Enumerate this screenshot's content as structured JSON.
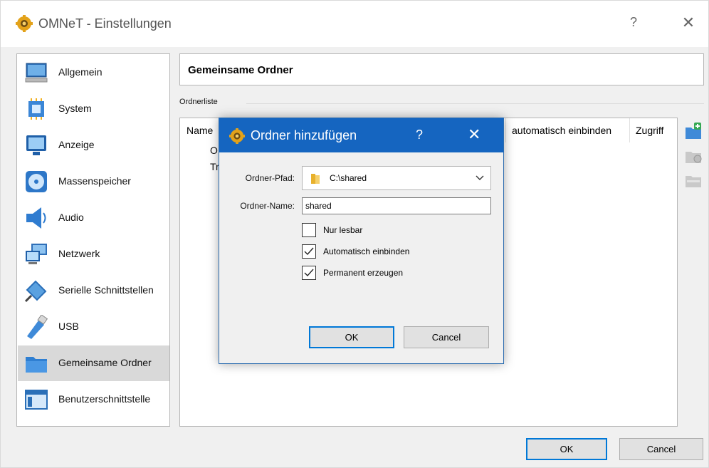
{
  "window": {
    "title": "OMNeT - Einstellungen",
    "help": "?",
    "close": "✕"
  },
  "sidebar": {
    "items": [
      {
        "label": "Allgemein",
        "icon": "monitor-general-icon"
      },
      {
        "label": "System",
        "icon": "chip-icon"
      },
      {
        "label": "Anzeige",
        "icon": "display-icon"
      },
      {
        "label": "Massenspeicher",
        "icon": "disc-icon"
      },
      {
        "label": "Audio",
        "icon": "speaker-icon"
      },
      {
        "label": "Netzwerk",
        "icon": "network-icon"
      },
      {
        "label": "Serielle Schnittstellen",
        "icon": "serial-port-icon"
      },
      {
        "label": "USB",
        "icon": "usb-icon"
      },
      {
        "label": "Gemeinsame Ordner",
        "icon": "folder-icon",
        "active": true
      },
      {
        "label": "Benutzerschnittstelle",
        "icon": "window-ui-icon"
      }
    ]
  },
  "panel": {
    "title": "Gemeinsame Ordner",
    "group_label": "Ordnerliste",
    "columns": {
      "name": "Name",
      "auto": "automatisch einbinden",
      "access": "Zugriff"
    },
    "tree_rows": [
      "O",
      "Tr"
    ]
  },
  "buttons": {
    "ok": "OK",
    "cancel": "Cancel"
  },
  "dialog": {
    "title": "Ordner hinzufügen",
    "help": "?",
    "close": "✕",
    "path_label": "Ordner-Pfad:",
    "path_value": "C:\\shared",
    "name_label": "Ordner-Name:",
    "name_value": "shared",
    "checkboxes": [
      {
        "label": "Nur lesbar",
        "checked": false
      },
      {
        "label": "Automatisch einbinden",
        "checked": true
      },
      {
        "label": "Permanent erzeugen",
        "checked": true
      }
    ],
    "ok": "OK",
    "cancel": "Cancel"
  },
  "colors": {
    "dialog_title_bar": "#1565c0",
    "accent": "#0078d7",
    "active_item": "#d9d9d9"
  }
}
